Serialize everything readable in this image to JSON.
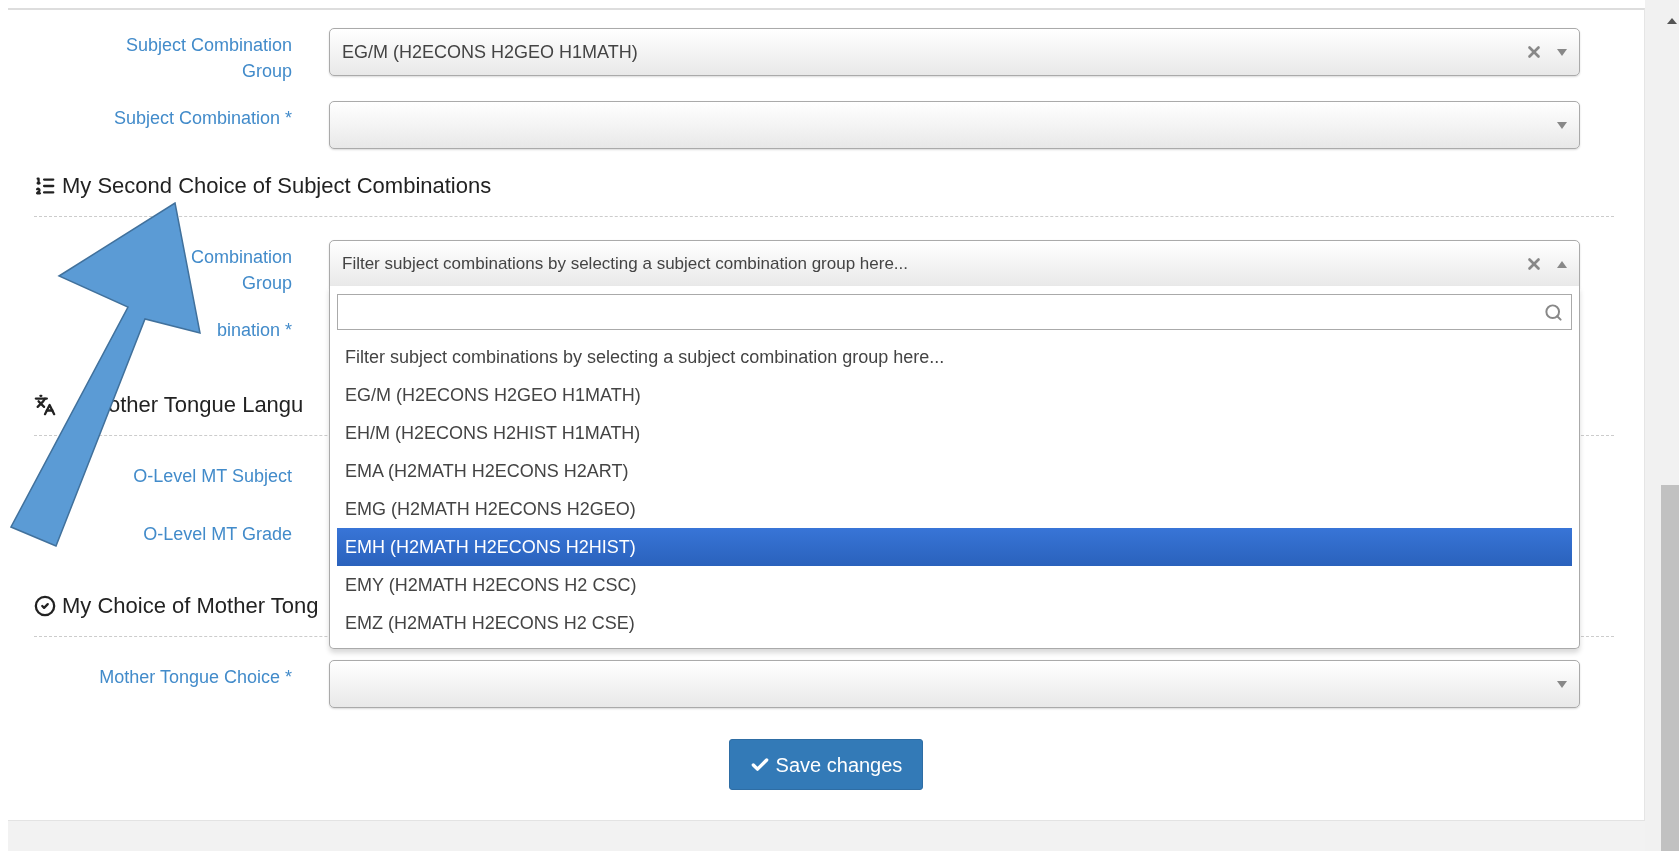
{
  "first_choice": {
    "fields": [
      {
        "label_lines": [
          "Subject Combination",
          "Group"
        ],
        "value": "EG/M (H2ECONS H2GEO H1MATH)",
        "clearable": true,
        "expanded": false
      },
      {
        "label_lines": [
          "Subject Combination *"
        ],
        "clearable": false,
        "expanded": false
      }
    ]
  },
  "second_choice": {
    "heading": "My Second Choice of Subject Combinations",
    "group_field": {
      "label_lines": [
        "Combination",
        "Group"
      ],
      "placeholder": "Filter subject combinations by selecting a subject combination group here...",
      "clearable": true,
      "expanded": true,
      "options": [
        {
          "text": "Filter subject combinations by selecting a subject combination group here...",
          "selected": false
        },
        {
          "text": "EG/M (H2ECONS H2GEO H1MATH)",
          "selected": false
        },
        {
          "text": "EH/M (H2ECONS H2HIST H1MATH)",
          "selected": false
        },
        {
          "text": "EMA (H2MATH H2ECONS H2ART)",
          "selected": false
        },
        {
          "text": "EMG (H2MATH H2ECONS H2GEO)",
          "selected": false
        },
        {
          "text": "EMH (H2MATH H2ECONS H2HIST)",
          "selected": true
        },
        {
          "text": "EMY (H2MATH H2ECONS H2 CSC)",
          "selected": false
        },
        {
          "text": "EMZ (H2MATH H2ECONS H2 CSE)",
          "selected": false
        }
      ]
    },
    "combination_label": "bination *"
  },
  "mother_tongue_language": {
    "heading": "other Tongue Langu",
    "labels": [
      "O-Level MT Subject",
      "O-Level MT Grade"
    ]
  },
  "mother_tongue_choice": {
    "heading": "My Choice of Mother Tong",
    "field": {
      "label_lines": [
        "Mother Tongue Choice *"
      ],
      "clearable": false,
      "expanded": false
    }
  },
  "save_button": "Save changes"
}
